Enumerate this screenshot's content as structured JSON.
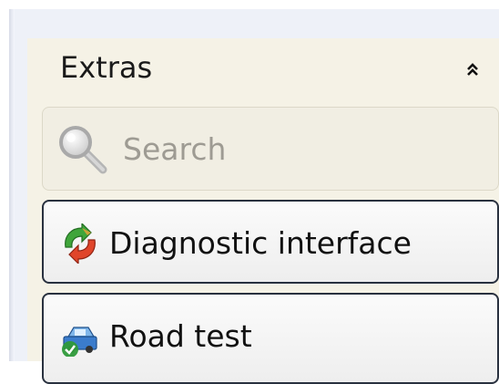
{
  "panel": {
    "title": "Extras",
    "collapse_icon": "double-chevron-up-icon"
  },
  "items": [
    {
      "label": "Search",
      "icon": "magnifier-icon",
      "state": "disabled"
    },
    {
      "label": "Diagnostic interface",
      "icon": "refresh-arrows-icon"
    },
    {
      "label": "Road test",
      "icon": "car-road-test-icon"
    }
  ],
  "colors": {
    "panel_background": "#f5f2e6",
    "button_border": "#29313f",
    "disabled_text": "#9e9b93"
  }
}
